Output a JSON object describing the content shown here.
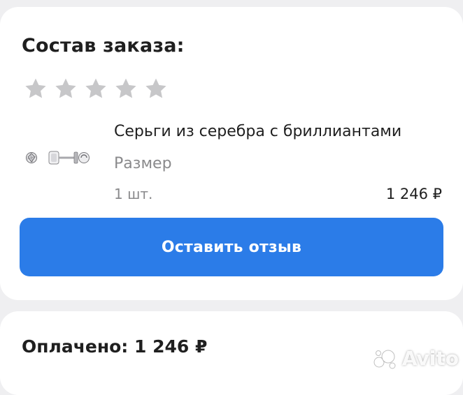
{
  "order": {
    "title": "Состав заказа:",
    "rating": {
      "stars_total": 5,
      "stars_filled": 0,
      "star_color": "#c7c7c9"
    },
    "item": {
      "name": "Серьги из серебра с бриллиантами",
      "size_label": "Размер",
      "quantity": "1 шт.",
      "price": "1 246 ₽"
    },
    "review_button_label": "Оставить отзыв"
  },
  "payment": {
    "paid_label": "Оплачено:",
    "paid_amount": "1 246 ₽"
  },
  "watermark": {
    "text": "Avito"
  },
  "colors": {
    "accent": "#2b7ce8",
    "background": "#efeff1",
    "card": "#ffffff",
    "text_primary": "#1f1f1f",
    "text_secondary": "#8a8a8c"
  }
}
